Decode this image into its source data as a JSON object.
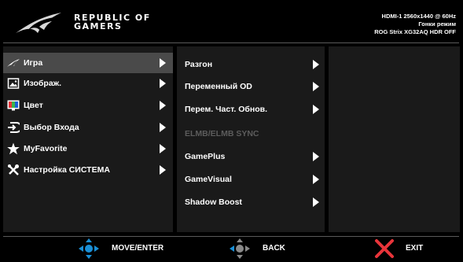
{
  "brand": {
    "line1": "REPUBLIC OF",
    "line2": "GAMERS"
  },
  "status": {
    "input_info": "HDMI-1  2560x1440 @ 60Hz",
    "mode": "Гонки режим",
    "model_info": "ROG Strix XG32AQ HDR OFF"
  },
  "main_menu": [
    {
      "label": "Игра",
      "icon": "rog-eye-icon",
      "selected": true
    },
    {
      "label": "Изображ.",
      "icon": "image-icon"
    },
    {
      "label": "Цвет",
      "icon": "color-icon"
    },
    {
      "label": "Выбор Входа",
      "icon": "input-icon"
    },
    {
      "label": "MyFavorite",
      "icon": "star-icon"
    },
    {
      "label": "Настройка СИСТЕМА",
      "icon": "wrench-icon"
    }
  ],
  "sub_menu": [
    {
      "label": "Разгон",
      "has_arrow": true
    },
    {
      "label": "Переменный OD",
      "has_arrow": true
    },
    {
      "label": "Перем. Част. Обнов.",
      "has_arrow": true
    },
    {
      "label": "ELMB/ELMB SYNC",
      "has_arrow": false,
      "disabled": true
    },
    {
      "label": "GamePlus",
      "has_arrow": true
    },
    {
      "label": "GameVisual",
      "has_arrow": true
    },
    {
      "label": "Shadow Boost",
      "has_arrow": true
    }
  ],
  "footer": {
    "move_enter": "MOVE/ENTER",
    "back": "BACK",
    "exit": "EXIT"
  },
  "colors": {
    "background": "#000000",
    "panel": "#1a1a1a",
    "selected": "#4a4a4a",
    "disabled_text": "#5c5c5c",
    "nav_blue": "#1a8fd6",
    "back_gray": "#8a8a8a",
    "exit_red": "#e8343a"
  }
}
